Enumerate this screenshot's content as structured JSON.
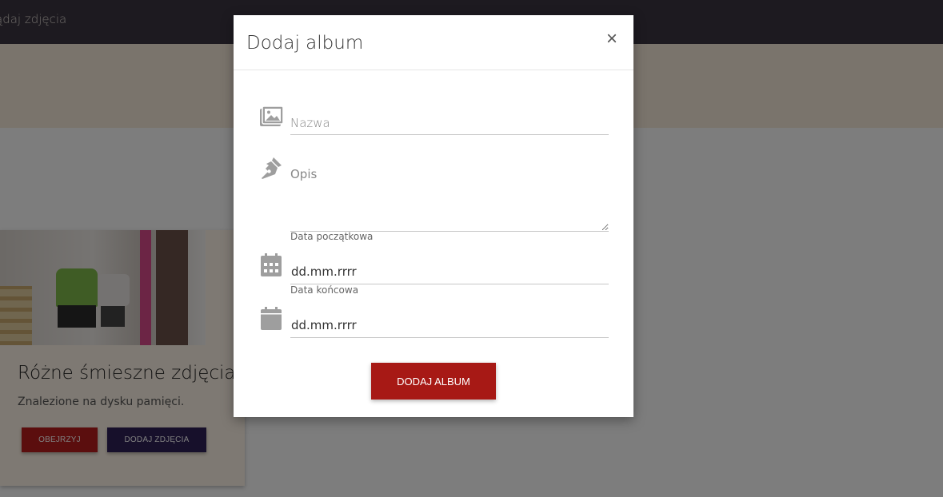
{
  "navbar": {
    "link_label": "ądaj zdjęcia"
  },
  "card": {
    "title": "Różne śmieszne zdjęcia",
    "description": "Znalezione na dysku pamięci.",
    "view_button": "OBEJRZYJ",
    "add_photos_button": "DODAJ ZDJĘCIA"
  },
  "modal": {
    "title": "Dodaj album",
    "close_symbol": "×",
    "name_field": {
      "placeholder": "Nazwa",
      "value": "",
      "icon": "images-icon"
    },
    "description_field": {
      "placeholder": "Opis",
      "value": "",
      "icon": "pen-nib-icon"
    },
    "start_date": {
      "label": "Data początkowa",
      "value": "dd.mm.rrrr",
      "icon": "calendar-grid-icon"
    },
    "end_date": {
      "label": "Data końcowa",
      "value": "dd.mm.rrrr",
      "icon": "calendar-icon"
    },
    "submit_button": "DODAJ ALBUM"
  },
  "colors": {
    "navbar": "#3a3440",
    "primary_red": "#a71915",
    "dark_purple": "#2e2157",
    "icon_gray": "#9e9e9e"
  }
}
